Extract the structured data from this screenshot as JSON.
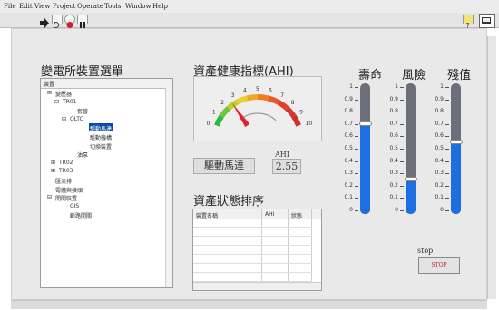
{
  "menu": [
    "File",
    "Edit",
    "View",
    "Project",
    "Operate",
    "Tools",
    "Window",
    "Help"
  ],
  "toolbar": {
    "run_icon": "run-arrow-icon",
    "continuous_icon": "run-continuous-icon",
    "abort_icon": "abort-icon",
    "pause_icon": "pause-icon"
  },
  "headings": {
    "device_selection": "變電所裝置選單",
    "ahi_title": "資產健康指標(AHI)",
    "ranking_title": "資產狀態排序",
    "life": "壽命",
    "risk": "風險",
    "residual": "殘值"
  },
  "tree": {
    "header": "裝置",
    "items": [
      {
        "label": "變壓器",
        "prefix": "⊟",
        "selected": false
      },
      {
        "label": "TR01",
        "prefix": "⊟",
        "selected": false
      },
      {
        "label": "套管",
        "prefix": "",
        "selected": false
      },
      {
        "label": "OLTC",
        "prefix": "⊟",
        "selected": false
      },
      {
        "label": "驅動馬達",
        "prefix": "",
        "selected": true
      },
      {
        "label": "驅動機構",
        "prefix": "",
        "selected": false
      },
      {
        "label": "切換裝置",
        "prefix": "",
        "selected": false
      },
      {
        "label": "油泵",
        "prefix": "",
        "selected": false
      },
      {
        "label": "TR02",
        "prefix": "⊞",
        "selected": false
      },
      {
        "label": "TR03",
        "prefix": "⊞",
        "selected": false
      },
      {
        "label": "匯流排",
        "prefix": "",
        "selected": false
      },
      {
        "label": "電纜與接頭",
        "prefix": "",
        "selected": false
      },
      {
        "label": "開關裝置",
        "prefix": "⊟",
        "selected": false
      },
      {
        "label": "GIS",
        "prefix": "",
        "selected": false
      },
      {
        "label": "斷路開關",
        "prefix": "",
        "selected": false
      }
    ]
  },
  "gauge": {
    "ticks": [
      "0",
      "1",
      "2",
      "3",
      "4",
      "5",
      "6",
      "7",
      "8",
      "9",
      "10"
    ],
    "value": 2.55,
    "min": 0,
    "max": 10
  },
  "ahi": {
    "label": "AHI",
    "value": "2.55",
    "device": "驅動馬達"
  },
  "ranking_table": {
    "columns": [
      "裝置名稱",
      "AHI",
      "狀態"
    ]
  },
  "sliders": {
    "ticks": [
      "1",
      "0.9",
      "0.8",
      "0.7",
      "0.6",
      "0.5",
      "0.4",
      "0.3",
      "0.2",
      "0.1",
      "0"
    ],
    "life_value": 0.7,
    "risk_value": 0.25,
    "residual_value": 0.55
  },
  "stop": {
    "caption": "stop",
    "button_label": "STOP"
  },
  "colors": {
    "slider_fill": "#1d6fe0",
    "slider_track": "#6c6e7a",
    "needle": "#e0202a"
  }
}
